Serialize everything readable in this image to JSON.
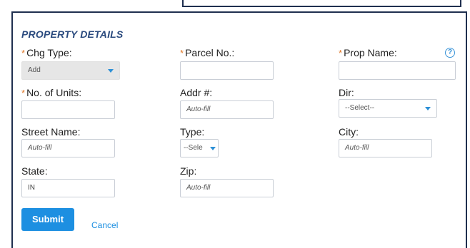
{
  "section": {
    "title": "PROPERTY DETAILS"
  },
  "fields": {
    "chg_type": {
      "label": "Chg Type:",
      "required": "*",
      "value": "Add"
    },
    "parcel_no": {
      "label": "Parcel No.:",
      "required": "*",
      "value": ""
    },
    "prop_name": {
      "label": "Prop Name:",
      "required": "*",
      "value": ""
    },
    "num_units": {
      "label": "No. of Units:",
      "required": "*",
      "value": ""
    },
    "addr_num": {
      "label": "Addr #:",
      "placeholder": "Auto-fill"
    },
    "dir": {
      "label": "Dir:",
      "value": "--Select--"
    },
    "street_name": {
      "label": "Street Name:",
      "placeholder": "Auto-fill"
    },
    "type": {
      "label": "Type:",
      "value": "--Sele"
    },
    "city": {
      "label": "City:",
      "placeholder": "Auto-fill"
    },
    "state": {
      "label": "State:",
      "value": "IN"
    },
    "zip": {
      "label": "Zip:",
      "placeholder": "Auto-fill"
    }
  },
  "help": {
    "glyph": "?"
  },
  "actions": {
    "submit_label": "Submit",
    "cancel_label": "Cancel"
  },
  "colors": {
    "accent": "#1d8fe1",
    "required": "#e0792a",
    "title": "#2a4a7e",
    "border": "#1f2f4f"
  }
}
